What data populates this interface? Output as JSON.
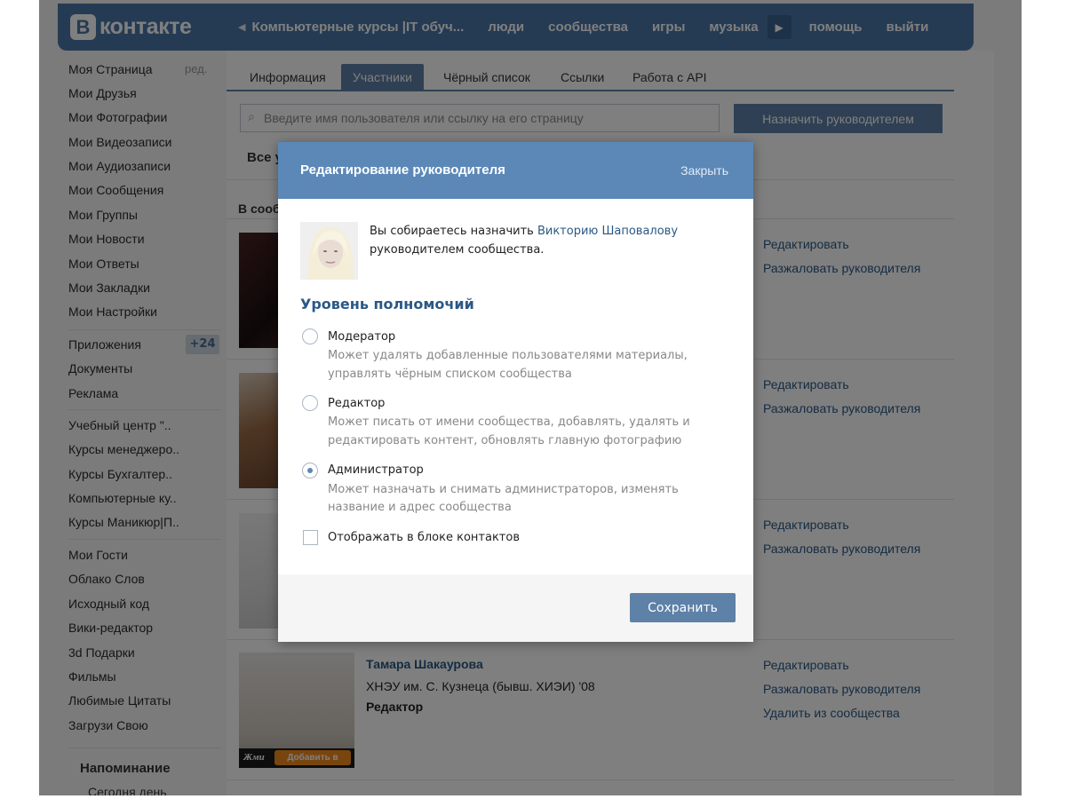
{
  "header": {
    "logo_letter": "В",
    "logo_text": "контакте",
    "nav": [
      "Компьютерные курсы |IT обуч...",
      "люди",
      "сообщества",
      "игры",
      "музыка",
      "помощь",
      "выйти"
    ]
  },
  "sidebar": {
    "edit_label": "ред.",
    "items_group1": [
      "Моя Страница",
      "Мои Друзья",
      "Мои Фотографии",
      "Мои Видеозаписи",
      "Мои Аудиозаписи",
      "Мои Сообщения",
      "Мои Группы",
      "Мои Новости",
      "Мои Ответы",
      "Мои Закладки",
      "Мои Настройки"
    ],
    "items_group2": [
      "Приложения",
      "Документы",
      "Реклама"
    ],
    "apps_badge": "+24",
    "items_group3": [
      "Учебный центр \"..",
      "Курсы менеджеро..",
      "Курсы Бухгалтер..",
      "Компьютерные ку..",
      "Курсы Маникюр|П.."
    ],
    "items_group4": [
      "Мои Гости",
      "Облако Слов",
      "Исходный код",
      "Вики-редактор",
      "3d Подарки",
      "Фильмы",
      "Любимые Цитаты",
      "Загрузи Свою"
    ],
    "reminder_title": "Напоминание",
    "reminder_text": "Сегодня день"
  },
  "main": {
    "tabs": [
      {
        "label": "Информация"
      },
      {
        "label": "Участники"
      },
      {
        "label": "Чёрный список"
      },
      {
        "label": "Ссылки"
      },
      {
        "label": "Работа с API"
      }
    ],
    "active_tab": "Участники",
    "search_placeholder": "Введите имя пользователя или ссылку на его страницу",
    "assign_button": "Назначить руководителем",
    "filter_label": "Все у",
    "section_title": "В сооб",
    "members": [
      {
        "actions": [
          "Редактировать",
          "Разжаловать руководителя"
        ]
      },
      {
        "actions": [
          "Редактировать",
          "Разжаловать руководителя"
        ]
      },
      {
        "actions": [
          "Редактировать",
          "Разжаловать руководителя"
        ]
      },
      {
        "name": "Тамара Шакаурова",
        "info": "ХНЭУ им. С. Кузнеца (бывш. ХИЭИ) '08",
        "role": "Редактор",
        "actions": [
          "Редактировать",
          "Разжаловать руководителя",
          "Удалить из сообщества"
        ],
        "badge_jmi": "Жми",
        "badge_add": "Добавить в друзья"
      }
    ]
  },
  "modal": {
    "title": "Редактирование руководителя",
    "close": "Закрыть",
    "text_before_link": "Вы собираетесь назначить ",
    "link_name": "Викторию Шаповалову",
    "text_line2": "руководителем сообщества.",
    "perm_title": "Уровень полномочий",
    "options": [
      {
        "title": "Модератор",
        "desc": [
          "Может удалять добавленные пользователями материалы,",
          "управлять чёрным списком сообщества"
        ],
        "checked": false
      },
      {
        "title": "Редактор",
        "desc": [
          "Может писать от имени сообщества, добавлять, удалять и",
          "редактировать контент, обновлять главную фотографию"
        ],
        "checked": false
      },
      {
        "title": "Администратор",
        "desc": [
          "Может назначать и снимать администраторов, изменять",
          "название и адрес сообщества"
        ],
        "checked": true
      }
    ],
    "show_contacts_label": "Отображать в блоке контактов",
    "show_contacts_checked": false,
    "save_button": "Сохранить"
  },
  "colors": {
    "brand": "#4a76a8",
    "link": "#2a5885",
    "modal_header": "#5b88b7"
  }
}
